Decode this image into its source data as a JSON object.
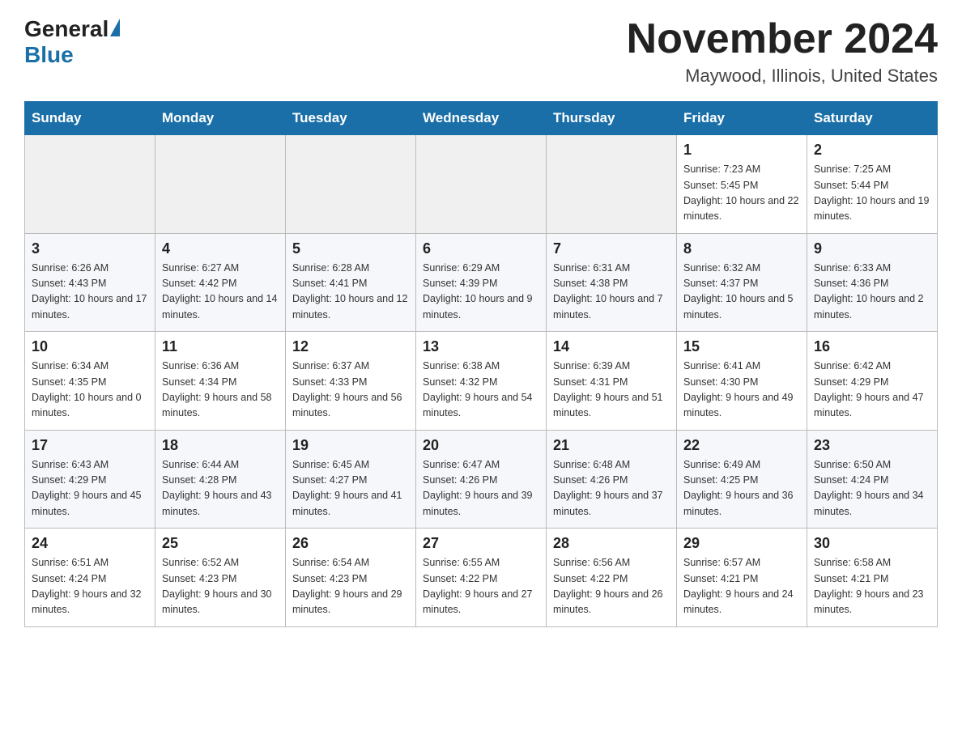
{
  "header": {
    "logo_general": "General",
    "logo_blue": "Blue",
    "month_title": "November 2024",
    "location": "Maywood, Illinois, United States"
  },
  "weekdays": [
    "Sunday",
    "Monday",
    "Tuesday",
    "Wednesday",
    "Thursday",
    "Friday",
    "Saturday"
  ],
  "rows": [
    [
      {
        "day": "",
        "sunrise": "",
        "sunset": "",
        "daylight": ""
      },
      {
        "day": "",
        "sunrise": "",
        "sunset": "",
        "daylight": ""
      },
      {
        "day": "",
        "sunrise": "",
        "sunset": "",
        "daylight": ""
      },
      {
        "day": "",
        "sunrise": "",
        "sunset": "",
        "daylight": ""
      },
      {
        "day": "",
        "sunrise": "",
        "sunset": "",
        "daylight": ""
      },
      {
        "day": "1",
        "sunrise": "Sunrise: 7:23 AM",
        "sunset": "Sunset: 5:45 PM",
        "daylight": "Daylight: 10 hours and 22 minutes."
      },
      {
        "day": "2",
        "sunrise": "Sunrise: 7:25 AM",
        "sunset": "Sunset: 5:44 PM",
        "daylight": "Daylight: 10 hours and 19 minutes."
      }
    ],
    [
      {
        "day": "3",
        "sunrise": "Sunrise: 6:26 AM",
        "sunset": "Sunset: 4:43 PM",
        "daylight": "Daylight: 10 hours and 17 minutes."
      },
      {
        "day": "4",
        "sunrise": "Sunrise: 6:27 AM",
        "sunset": "Sunset: 4:42 PM",
        "daylight": "Daylight: 10 hours and 14 minutes."
      },
      {
        "day": "5",
        "sunrise": "Sunrise: 6:28 AM",
        "sunset": "Sunset: 4:41 PM",
        "daylight": "Daylight: 10 hours and 12 minutes."
      },
      {
        "day": "6",
        "sunrise": "Sunrise: 6:29 AM",
        "sunset": "Sunset: 4:39 PM",
        "daylight": "Daylight: 10 hours and 9 minutes."
      },
      {
        "day": "7",
        "sunrise": "Sunrise: 6:31 AM",
        "sunset": "Sunset: 4:38 PM",
        "daylight": "Daylight: 10 hours and 7 minutes."
      },
      {
        "day": "8",
        "sunrise": "Sunrise: 6:32 AM",
        "sunset": "Sunset: 4:37 PM",
        "daylight": "Daylight: 10 hours and 5 minutes."
      },
      {
        "day": "9",
        "sunrise": "Sunrise: 6:33 AM",
        "sunset": "Sunset: 4:36 PM",
        "daylight": "Daylight: 10 hours and 2 minutes."
      }
    ],
    [
      {
        "day": "10",
        "sunrise": "Sunrise: 6:34 AM",
        "sunset": "Sunset: 4:35 PM",
        "daylight": "Daylight: 10 hours and 0 minutes."
      },
      {
        "day": "11",
        "sunrise": "Sunrise: 6:36 AM",
        "sunset": "Sunset: 4:34 PM",
        "daylight": "Daylight: 9 hours and 58 minutes."
      },
      {
        "day": "12",
        "sunrise": "Sunrise: 6:37 AM",
        "sunset": "Sunset: 4:33 PM",
        "daylight": "Daylight: 9 hours and 56 minutes."
      },
      {
        "day": "13",
        "sunrise": "Sunrise: 6:38 AM",
        "sunset": "Sunset: 4:32 PM",
        "daylight": "Daylight: 9 hours and 54 minutes."
      },
      {
        "day": "14",
        "sunrise": "Sunrise: 6:39 AM",
        "sunset": "Sunset: 4:31 PM",
        "daylight": "Daylight: 9 hours and 51 minutes."
      },
      {
        "day": "15",
        "sunrise": "Sunrise: 6:41 AM",
        "sunset": "Sunset: 4:30 PM",
        "daylight": "Daylight: 9 hours and 49 minutes."
      },
      {
        "day": "16",
        "sunrise": "Sunrise: 6:42 AM",
        "sunset": "Sunset: 4:29 PM",
        "daylight": "Daylight: 9 hours and 47 minutes."
      }
    ],
    [
      {
        "day": "17",
        "sunrise": "Sunrise: 6:43 AM",
        "sunset": "Sunset: 4:29 PM",
        "daylight": "Daylight: 9 hours and 45 minutes."
      },
      {
        "day": "18",
        "sunrise": "Sunrise: 6:44 AM",
        "sunset": "Sunset: 4:28 PM",
        "daylight": "Daylight: 9 hours and 43 minutes."
      },
      {
        "day": "19",
        "sunrise": "Sunrise: 6:45 AM",
        "sunset": "Sunset: 4:27 PM",
        "daylight": "Daylight: 9 hours and 41 minutes."
      },
      {
        "day": "20",
        "sunrise": "Sunrise: 6:47 AM",
        "sunset": "Sunset: 4:26 PM",
        "daylight": "Daylight: 9 hours and 39 minutes."
      },
      {
        "day": "21",
        "sunrise": "Sunrise: 6:48 AM",
        "sunset": "Sunset: 4:26 PM",
        "daylight": "Daylight: 9 hours and 37 minutes."
      },
      {
        "day": "22",
        "sunrise": "Sunrise: 6:49 AM",
        "sunset": "Sunset: 4:25 PM",
        "daylight": "Daylight: 9 hours and 36 minutes."
      },
      {
        "day": "23",
        "sunrise": "Sunrise: 6:50 AM",
        "sunset": "Sunset: 4:24 PM",
        "daylight": "Daylight: 9 hours and 34 minutes."
      }
    ],
    [
      {
        "day": "24",
        "sunrise": "Sunrise: 6:51 AM",
        "sunset": "Sunset: 4:24 PM",
        "daylight": "Daylight: 9 hours and 32 minutes."
      },
      {
        "day": "25",
        "sunrise": "Sunrise: 6:52 AM",
        "sunset": "Sunset: 4:23 PM",
        "daylight": "Daylight: 9 hours and 30 minutes."
      },
      {
        "day": "26",
        "sunrise": "Sunrise: 6:54 AM",
        "sunset": "Sunset: 4:23 PM",
        "daylight": "Daylight: 9 hours and 29 minutes."
      },
      {
        "day": "27",
        "sunrise": "Sunrise: 6:55 AM",
        "sunset": "Sunset: 4:22 PM",
        "daylight": "Daylight: 9 hours and 27 minutes."
      },
      {
        "day": "28",
        "sunrise": "Sunrise: 6:56 AM",
        "sunset": "Sunset: 4:22 PM",
        "daylight": "Daylight: 9 hours and 26 minutes."
      },
      {
        "day": "29",
        "sunrise": "Sunrise: 6:57 AM",
        "sunset": "Sunset: 4:21 PM",
        "daylight": "Daylight: 9 hours and 24 minutes."
      },
      {
        "day": "30",
        "sunrise": "Sunrise: 6:58 AM",
        "sunset": "Sunset: 4:21 PM",
        "daylight": "Daylight: 9 hours and 23 minutes."
      }
    ]
  ]
}
